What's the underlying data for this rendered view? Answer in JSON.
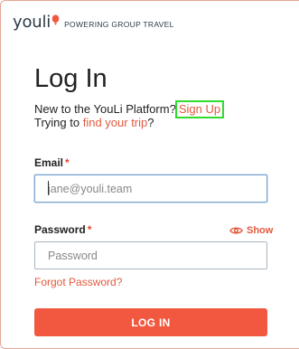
{
  "brand": {
    "logo_text": "youli",
    "tagline": "POWERING GROUP TRAVEL",
    "accent_color": "#f1583f"
  },
  "page": {
    "title": "Log In",
    "new_user_prefix": "New to the YouLi Platform?",
    "signup_link": "Sign Up",
    "trip_prefix": "Trying to",
    "trip_link": "find your trip",
    "trip_suffix": "?"
  },
  "form": {
    "email": {
      "label": "Email",
      "required_mark": "*",
      "placeholder": "jane@youli.team",
      "value": ""
    },
    "password": {
      "label": "Password",
      "required_mark": "*",
      "placeholder": "Password",
      "value": "",
      "show_label": "Show",
      "show_icon": "eye-icon"
    },
    "forgot_link": "Forgot Password?",
    "submit_label": "LOG IN"
  }
}
